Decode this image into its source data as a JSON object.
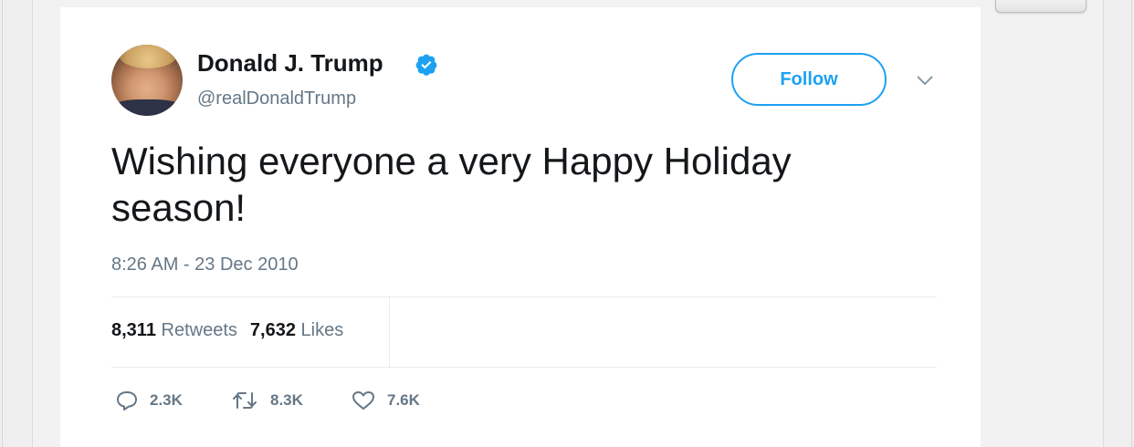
{
  "tweet": {
    "author_name": "Donald J. Trump",
    "author_handle": "@realDonaldTrump",
    "follow_label": "Follow",
    "text": "Wishing everyone a very Happy Holiday season!",
    "timestamp": "8:26 AM - 23 Dec 2010",
    "retweets_count": "8,311",
    "retweets_label": "Retweets",
    "likes_count": "7,632",
    "likes_label": "Likes",
    "actions": {
      "replies": "2.3K",
      "retweets": "8.3K",
      "likes": "7.6K"
    },
    "icons": {
      "verified": "verified-badge-icon",
      "caret": "chevron-down-icon",
      "reply": "reply-icon",
      "retweet": "retweet-icon",
      "like": "heart-icon"
    }
  },
  "colors": {
    "accent": "#1da1f2",
    "text_primary": "#14171a",
    "text_secondary": "#657786",
    "divider": "#e6ecf0"
  }
}
